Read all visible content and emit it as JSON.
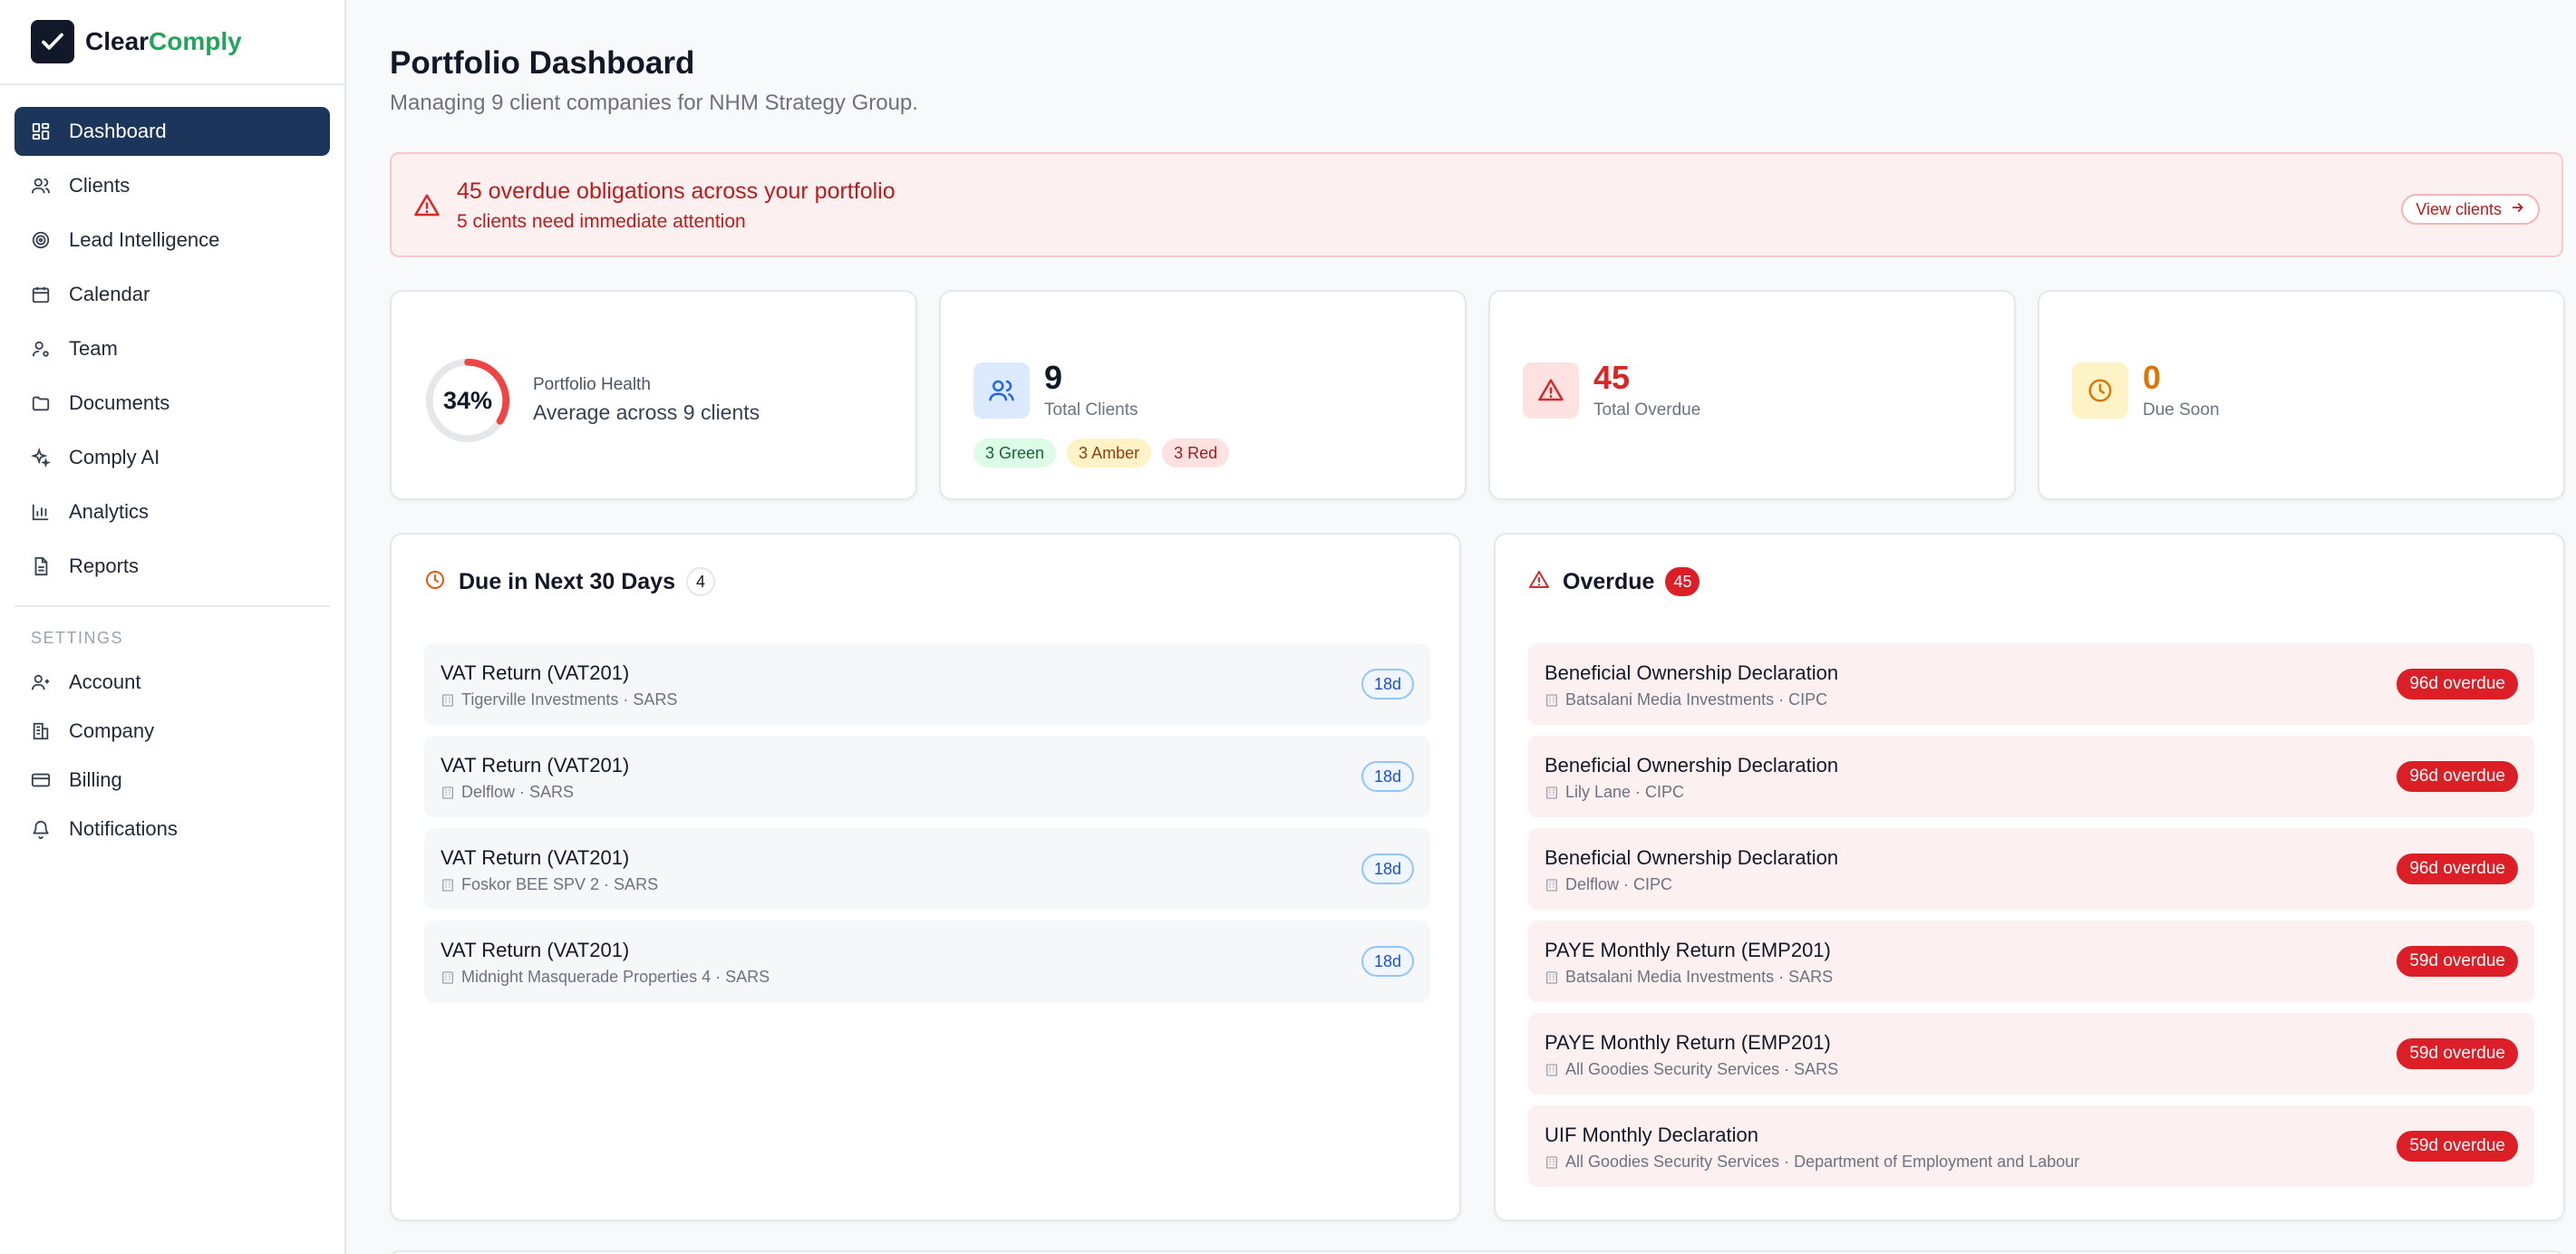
{
  "brand": {
    "name_part1": "Clear",
    "name_part2": "Comply",
    "accent_color": "#22a55b"
  },
  "sidebar": {
    "nav": [
      {
        "label": "Dashboard",
        "icon": "dashboard-icon",
        "active": true
      },
      {
        "label": "Clients",
        "icon": "users-icon"
      },
      {
        "label": "Lead Intelligence",
        "icon": "target-icon"
      },
      {
        "label": "Calendar",
        "icon": "calendar-icon"
      },
      {
        "label": "Team",
        "icon": "team-icon"
      },
      {
        "label": "Documents",
        "icon": "folder-icon"
      },
      {
        "label": "Comply AI",
        "icon": "sparkles-icon"
      },
      {
        "label": "Analytics",
        "icon": "bar-chart-icon"
      },
      {
        "label": "Reports",
        "icon": "file-text-icon"
      }
    ],
    "settings_label": "SETTINGS",
    "settings": [
      {
        "label": "Account",
        "icon": "user-icon"
      },
      {
        "label": "Company",
        "icon": "building-icon"
      },
      {
        "label": "Billing",
        "icon": "credit-card-icon"
      },
      {
        "label": "Notifications",
        "icon": "bell-icon"
      }
    ]
  },
  "header": {
    "title": "Portfolio Dashboard",
    "subtitle": "Managing 9 client companies for NHM Strategy Group."
  },
  "alert": {
    "title": "45 overdue obligations across your portfolio",
    "subtitle": "5 clients need immediate attention",
    "button_label": "View clients"
  },
  "stats": {
    "health": {
      "value_label": "34%",
      "value": 0.34,
      "title": "Portfolio Health",
      "subtitle": "Average across 9 clients"
    },
    "clients": {
      "value": "9",
      "label": "Total Clients",
      "green": "3 Green",
      "amber": "3 Amber",
      "red": "3 Red"
    },
    "overdue": {
      "value": "45",
      "label": "Total Overdue",
      "color": "#dc2626"
    },
    "due_soon": {
      "value": "0",
      "label": "Due Soon",
      "color": "#d97706"
    }
  },
  "due_panel": {
    "title": "Due in Next 30 Days",
    "count": "4",
    "items": [
      {
        "title": "VAT Return (VAT201)",
        "meta": "Tigerville Investments · SARS",
        "days": "18d"
      },
      {
        "title": "VAT Return (VAT201)",
        "meta": "Delflow · SARS",
        "days": "18d"
      },
      {
        "title": "VAT Return (VAT201)",
        "meta": "Foskor BEE SPV 2 · SARS",
        "days": "18d"
      },
      {
        "title": "VAT Return (VAT201)",
        "meta": "Midnight Masquerade Properties 4 · SARS",
        "days": "18d"
      }
    ]
  },
  "overdue_panel": {
    "title": "Overdue",
    "count": "45",
    "items": [
      {
        "title": "Beneficial Ownership Declaration",
        "meta": "Batsalani Media Investments · CIPC",
        "status": "96d overdue"
      },
      {
        "title": "Beneficial Ownership Declaration",
        "meta": "Lily Lane · CIPC",
        "status": "96d overdue"
      },
      {
        "title": "Beneficial Ownership Declaration",
        "meta": "Delflow · CIPC",
        "status": "96d overdue"
      },
      {
        "title": "PAYE Monthly Return (EMP201)",
        "meta": "Batsalani Media Investments · SARS",
        "status": "59d overdue"
      },
      {
        "title": "PAYE Monthly Return (EMP201)",
        "meta": "All Goodies Security Services · SARS",
        "status": "59d overdue"
      },
      {
        "title": "UIF Monthly Declaration",
        "meta": "All Goodies Security Services · Department of Employment and Labour",
        "status": "59d overdue"
      }
    ]
  }
}
